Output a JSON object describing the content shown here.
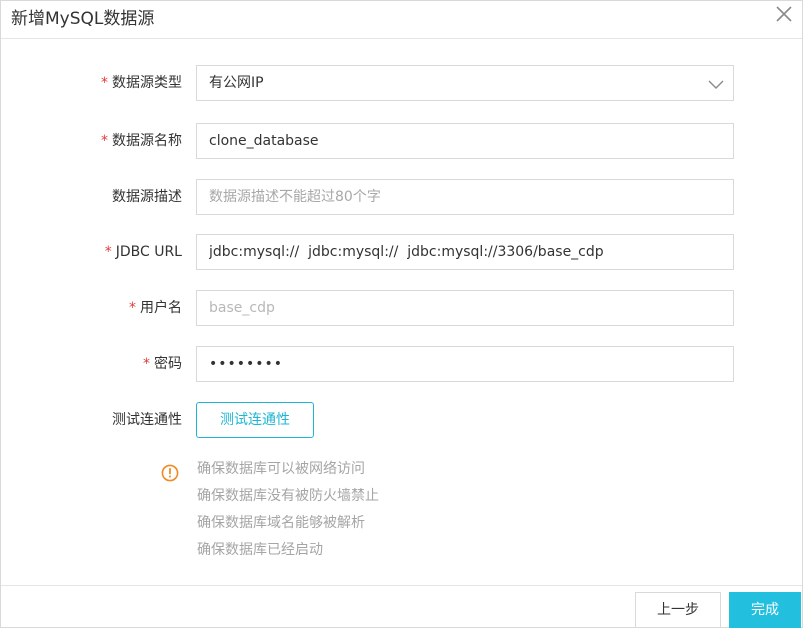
{
  "dialog": {
    "title": "新增MySQL数据源"
  },
  "form": {
    "required_mark": "*",
    "source_type": {
      "label": "数据源类型",
      "value": "有公网IP"
    },
    "source_name": {
      "label": "数据源名称",
      "value": "clone_database"
    },
    "source_desc": {
      "label": "数据源描述",
      "value": "",
      "placeholder": "数据源描述不能超过80个字"
    },
    "jdbc_url": {
      "label": "JDBC URL",
      "value": "jdbc:mysql://  jdbc:mysql://  jdbc:mysql://3306/base_cdp"
    },
    "username": {
      "label": "用户名",
      "value": "base_cdp"
    },
    "password": {
      "label": "密码",
      "value": "••••••••"
    },
    "connectivity": {
      "label": "测试连通性",
      "button_label": "测试连通性"
    }
  },
  "tips": {
    "icon": "info-circle-icon",
    "lines": [
      "确保数据库可以被网络访问",
      "确保数据库没有被防火墙禁止",
      "确保数据库域名能够被解析",
      "确保数据库已经启动"
    ]
  },
  "footer": {
    "prev_label": "上一步",
    "done_label": "完成"
  },
  "colors": {
    "accent": "#22bfdf",
    "required": "#e23c39",
    "warning": "#f08a24"
  }
}
